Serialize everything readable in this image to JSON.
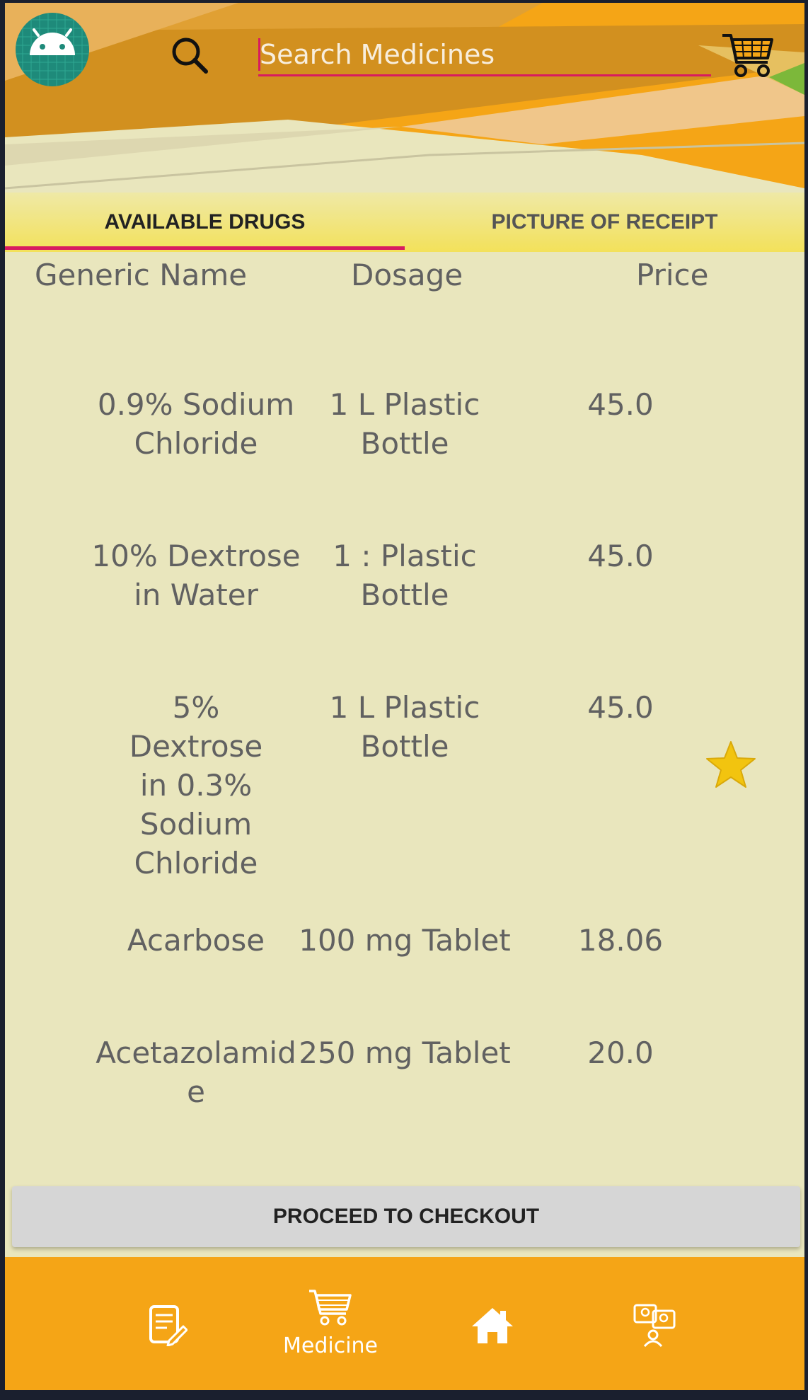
{
  "header": {
    "search_placeholder": "Search Medicines",
    "tabs": [
      {
        "label": "AVAILABLE DRUGS",
        "selected": true
      },
      {
        "label": "PICTURE OF RECEIPT",
        "selected": false
      }
    ]
  },
  "table": {
    "columns": [
      "Generic Name",
      "Dosage",
      "Price"
    ],
    "rows": [
      {
        "name": "0.9% Sodium Chloride",
        "dosage": "1 L Plastic Bottle",
        "price": "45.0"
      },
      {
        "name": "10% Dextrose in Water",
        "dosage": "1 : Plastic Bottle",
        "price": "45.0"
      },
      {
        "name": "5% Dextrose in 0.3% Sodium Chloride",
        "dosage": "1 L Plastic Bottle",
        "price": "45.0"
      },
      {
        "name": "Acarbose",
        "dosage": "100 mg Tablet",
        "price": "18.06"
      },
      {
        "name": "Acetazolamide",
        "dosage": "250 mg Tablet",
        "price": "20.0"
      }
    ]
  },
  "checkout": {
    "label": "PROCEED TO CHECKOUT"
  },
  "bottom_nav": {
    "items": [
      {
        "icon": "prescription-edit-icon",
        "label": ""
      },
      {
        "icon": "shopping-cart-icon",
        "label": "Medicine",
        "selected": true
      },
      {
        "icon": "home-icon",
        "label": ""
      },
      {
        "icon": "consultation-icon",
        "label": ""
      }
    ]
  },
  "colors": {
    "accent": "#d81b60",
    "header_orange": "#f5a516",
    "content_bg": "#e9e6bd",
    "tab_bar_yellow": "#f2e26a",
    "star": "#f2c40f"
  }
}
